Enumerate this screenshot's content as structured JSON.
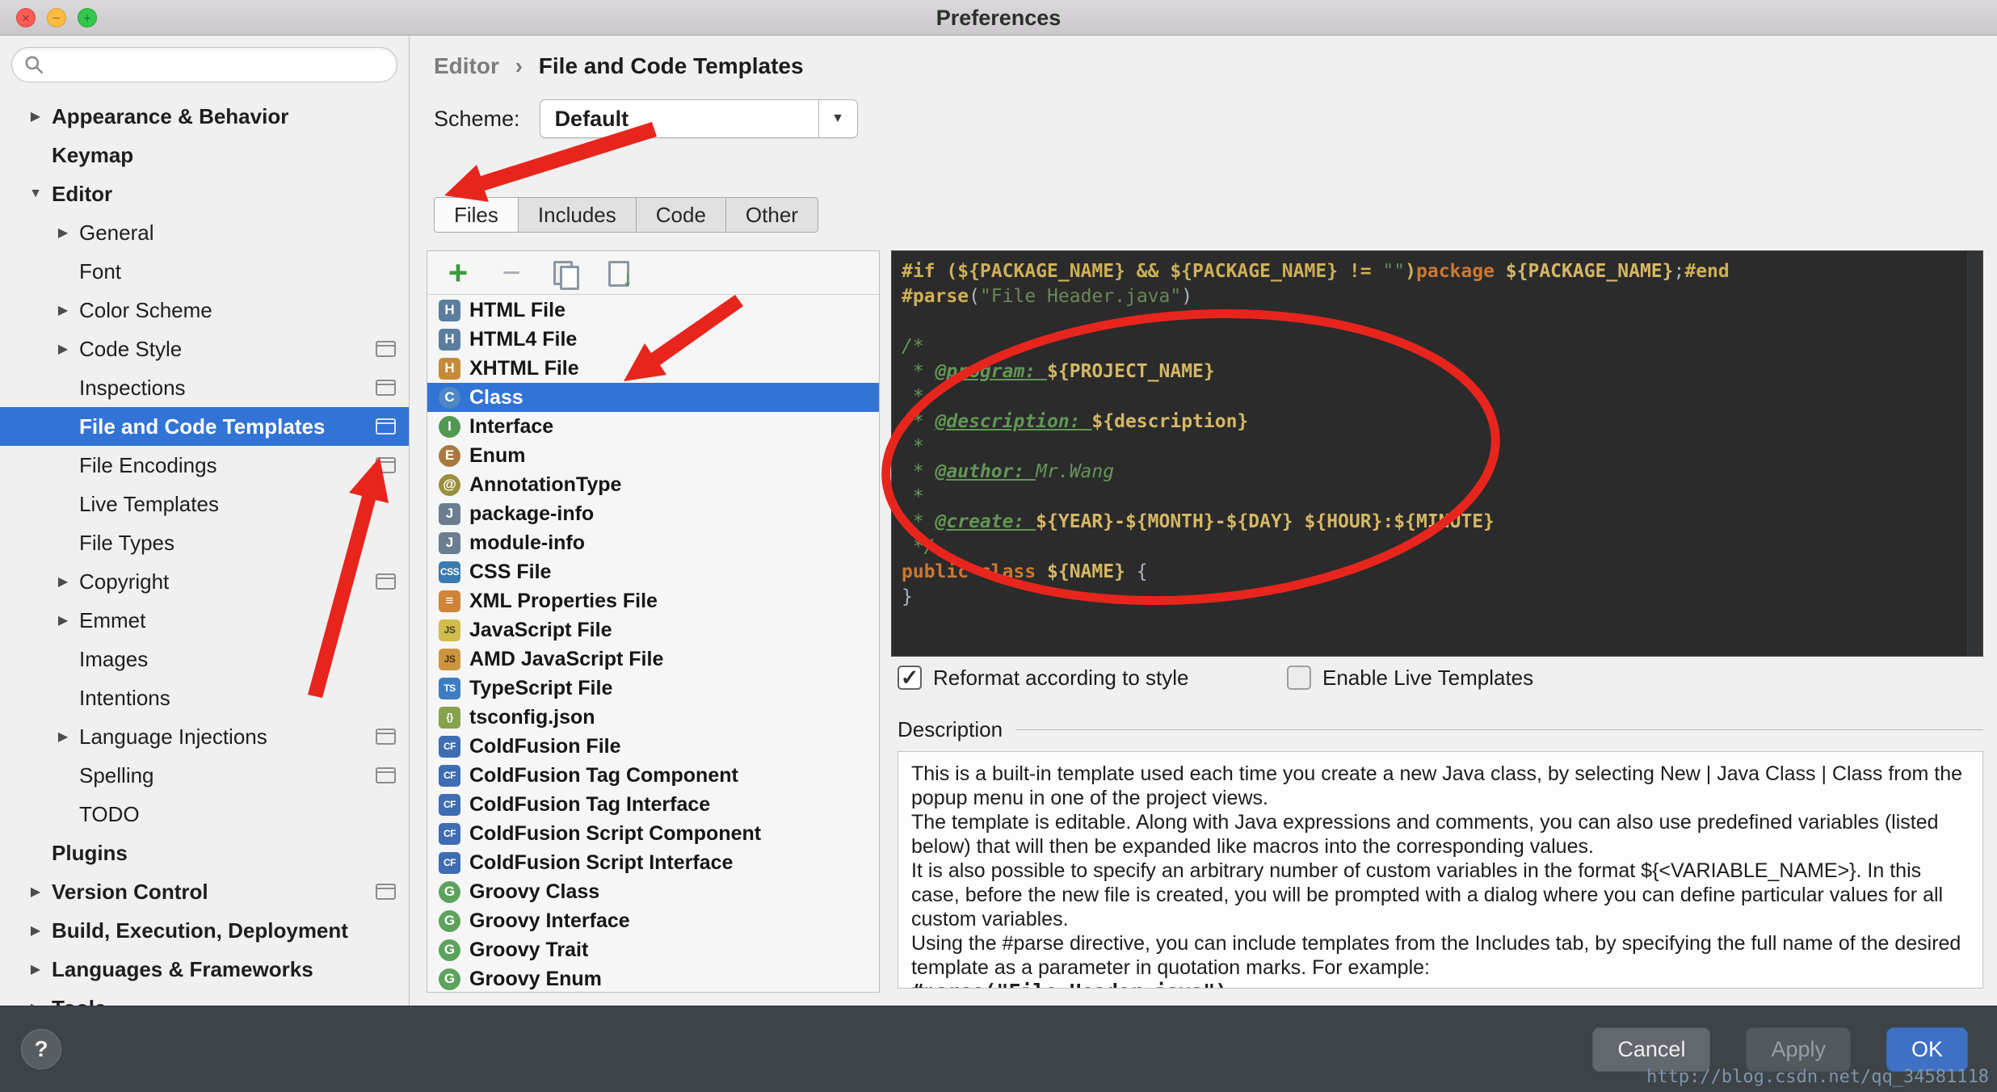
{
  "window": {
    "title": "Preferences"
  },
  "colors": {
    "selection": "#3273d6",
    "annotation": "#e8251d",
    "editor_background": "#2b2b2b",
    "code_directive": "#ceb056",
    "code_keyword": "#cc7832",
    "code_string": "#6a8759",
    "code_comment": "#629755",
    "code_plain": "#a9b7c6"
  },
  "sidebar": {
    "search_value": "",
    "items": [
      {
        "label": "Appearance & Behavior",
        "level": 0,
        "bold": true,
        "arrow": "right"
      },
      {
        "label": "Keymap",
        "level": 0,
        "bold": true,
        "arrow": "none"
      },
      {
        "label": "Editor",
        "level": 0,
        "bold": true,
        "arrow": "down"
      },
      {
        "label": "General",
        "level": 1,
        "arrow": "right"
      },
      {
        "label": "Font",
        "level": 1,
        "arrow": "none"
      },
      {
        "label": "Color Scheme",
        "level": 1,
        "arrow": "right"
      },
      {
        "label": "Code Style",
        "level": 1,
        "arrow": "right",
        "override": true
      },
      {
        "label": "Inspections",
        "level": 1,
        "arrow": "none",
        "override": true
      },
      {
        "label": "File and Code Templates",
        "level": 1,
        "arrow": "none",
        "override": true,
        "selected": true
      },
      {
        "label": "File Encodings",
        "level": 1,
        "arrow": "none",
        "override": true
      },
      {
        "label": "Live Templates",
        "level": 1,
        "arrow": "none"
      },
      {
        "label": "File Types",
        "level": 1,
        "arrow": "none"
      },
      {
        "label": "Copyright",
        "level": 1,
        "arrow": "right",
        "override": true
      },
      {
        "label": "Emmet",
        "level": 1,
        "arrow": "right"
      },
      {
        "label": "Images",
        "level": 1,
        "arrow": "none"
      },
      {
        "label": "Intentions",
        "level": 1,
        "arrow": "none"
      },
      {
        "label": "Language Injections",
        "level": 1,
        "arrow": "right",
        "override": true
      },
      {
        "label": "Spelling",
        "level": 1,
        "arrow": "none",
        "override": true
      },
      {
        "label": "TODO",
        "level": 1,
        "arrow": "none"
      },
      {
        "label": "Plugins",
        "level": 0,
        "bold": true,
        "arrow": "none"
      },
      {
        "label": "Version Control",
        "level": 0,
        "bold": true,
        "arrow": "right",
        "override": true
      },
      {
        "label": "Build, Execution, Deployment",
        "level": 0,
        "bold": true,
        "arrow": "right"
      },
      {
        "label": "Languages & Frameworks",
        "level": 0,
        "bold": true,
        "arrow": "right"
      },
      {
        "label": "Tools",
        "level": 0,
        "bold": true,
        "arrow": "right"
      }
    ]
  },
  "header": {
    "breadcrumb": [
      "Editor",
      "File and Code Templates"
    ],
    "breadcrumb_sep": "›",
    "scheme_label": "Scheme:",
    "scheme_value": "Default"
  },
  "tabs": [
    {
      "label": "Files",
      "active": true
    },
    {
      "label": "Includes"
    },
    {
      "label": "Code"
    },
    {
      "label": "Other"
    }
  ],
  "toolbar": {
    "icons": [
      "add",
      "remove",
      "copy",
      "import"
    ]
  },
  "file_list": [
    {
      "label": "HTML File",
      "icon": "H",
      "shape": "sq",
      "bg": "#5c7e9e"
    },
    {
      "label": "HTML4 File",
      "icon": "H",
      "shape": "sq",
      "bg": "#5c7e9e"
    },
    {
      "label": "XHTML File",
      "icon": "H",
      "shape": "sq",
      "bg": "#c78a3c"
    },
    {
      "label": "Class",
      "icon": "C",
      "shape": "ci",
      "bg": "#4e88c7",
      "selected": true
    },
    {
      "label": "Interface",
      "icon": "I",
      "shape": "ci",
      "bg": "#529752"
    },
    {
      "label": "Enum",
      "icon": "E",
      "shape": "ci",
      "bg": "#a8793f"
    },
    {
      "label": "AnnotationType",
      "icon": "@",
      "shape": "ci",
      "bg": "#9a8f3f"
    },
    {
      "label": "package-info",
      "icon": "J",
      "shape": "sq",
      "bg": "#6b7e90"
    },
    {
      "label": "module-info",
      "icon": "J",
      "shape": "sq",
      "bg": "#6b7e90"
    },
    {
      "label": "CSS File",
      "icon": "CSS",
      "shape": "sq",
      "bg": "#3a7ab2",
      "small": true
    },
    {
      "label": "XML Properties File",
      "icon": "≡",
      "shape": "sq",
      "bg": "#cf8538"
    },
    {
      "label": "JavaScript File",
      "icon": "JS",
      "shape": "sq",
      "bg": "#d2bc4b",
      "fg": "#4a4223",
      "small": true
    },
    {
      "label": "AMD JavaScript File",
      "icon": "JS",
      "shape": "sq",
      "bg": "#cd9440",
      "fg": "#433311",
      "small": true
    },
    {
      "label": "TypeScript File",
      "icon": "TS",
      "shape": "sq",
      "bg": "#3d7dc2",
      "small": true
    },
    {
      "label": "tsconfig.json",
      "icon": "{}",
      "shape": "sq",
      "bg": "#86a24e",
      "small": true
    },
    {
      "label": "ColdFusion File",
      "icon": "CF",
      "shape": "sq",
      "bg": "#3f6db3",
      "small": true
    },
    {
      "label": "ColdFusion Tag Component",
      "icon": "CF",
      "shape": "sq",
      "bg": "#3f6db3",
      "small": true
    },
    {
      "label": "ColdFusion Tag Interface",
      "icon": "CF",
      "shape": "sq",
      "bg": "#3f6db3",
      "small": true
    },
    {
      "label": "ColdFusion Script Component",
      "icon": "CF",
      "shape": "sq",
      "bg": "#3f6db3",
      "small": true
    },
    {
      "label": "ColdFusion Script Interface",
      "icon": "CF",
      "shape": "sq",
      "bg": "#3f6db3",
      "small": true
    },
    {
      "label": "Groovy Class",
      "icon": "G",
      "shape": "ci",
      "bg": "#5da25d"
    },
    {
      "label": "Groovy Interface",
      "icon": "G",
      "shape": "ci",
      "bg": "#5da25d"
    },
    {
      "label": "Groovy Trait",
      "icon": "G",
      "shape": "ci",
      "bg": "#5da25d"
    },
    {
      "label": "Groovy Enum",
      "icon": "G",
      "shape": "ci",
      "bg": "#5da25d"
    }
  ],
  "editor": {
    "lines": [
      [
        [
          "#if (${PACKAGE_NAME} && ${PACKAGE_NAME} != ",
          "d"
        ],
        [
          "\"\"",
          "s"
        ],
        [
          ")",
          "d"
        ],
        [
          "package ",
          "k"
        ],
        [
          "${PACKAGE_NAME}",
          "v"
        ],
        [
          ";",
          "p"
        ],
        [
          "#end",
          "d"
        ]
      ],
      [
        [
          "#parse",
          "d"
        ],
        [
          "(",
          "p"
        ],
        [
          "\"File Header.java\"",
          "s"
        ],
        [
          ")",
          "p"
        ]
      ],
      [],
      [
        [
          "/*",
          "c"
        ]
      ],
      [
        [
          " * ",
          "c"
        ],
        [
          "@program: ",
          "ct"
        ],
        [
          "${PROJECT_NAME}",
          "v"
        ]
      ],
      [
        [
          " *",
          "c"
        ]
      ],
      [
        [
          " * ",
          "c"
        ],
        [
          "@description: ",
          "ct"
        ],
        [
          "${description}",
          "v"
        ]
      ],
      [
        [
          " *",
          "c"
        ]
      ],
      [
        [
          " * ",
          "c"
        ],
        [
          "@author: ",
          "ct"
        ],
        [
          "Mr.Wang",
          "ci"
        ]
      ],
      [
        [
          " *",
          "c"
        ]
      ],
      [
        [
          " * ",
          "c"
        ],
        [
          "@create: ",
          "ct"
        ],
        [
          "${YEAR}-${MONTH}-${DAY} ${HOUR}:${MINUTE}",
          "v"
        ]
      ],
      [
        [
          " */",
          "c"
        ]
      ],
      [
        [
          "public class ",
          "k"
        ],
        [
          "${NAME}",
          "v"
        ],
        [
          " {",
          "p"
        ]
      ],
      [
        [
          "}",
          "p"
        ]
      ]
    ]
  },
  "options": {
    "reformat_label": "Reformat according to style",
    "reformat_checked": true,
    "live_templates_label": "Enable Live Templates",
    "live_templates_checked": false
  },
  "description": {
    "label": "Description",
    "paragraphs": [
      {
        "text": "This is a built-in template used each time you create a new Java class, by selecting New | Java Class | Class from the popup menu in one of the project views."
      },
      {
        "text": "The template is editable. Along with Java expressions and comments, you can also use predefined variables (listed below) that will then be expanded like macros into the corresponding values."
      },
      {
        "text": "It is also possible to specify an arbitrary number of custom variables in the format ${<VARIABLE_NAME>}. In this case, before the new file is created, you will be prompted with a dialog where you can define particular values for all custom variables."
      },
      {
        "text": "Using the #parse directive, you can include templates from the Includes tab, by specifying the full name of the desired template as a parameter in quotation marks. For example:"
      },
      {
        "text": "#parse(\"File Header.java\")",
        "mono": true
      }
    ]
  },
  "footer": {
    "help": "?",
    "cancel": "Cancel",
    "apply": "Apply",
    "ok": "OK"
  },
  "watermark": "http://blog.csdn.net/qq_34581118"
}
